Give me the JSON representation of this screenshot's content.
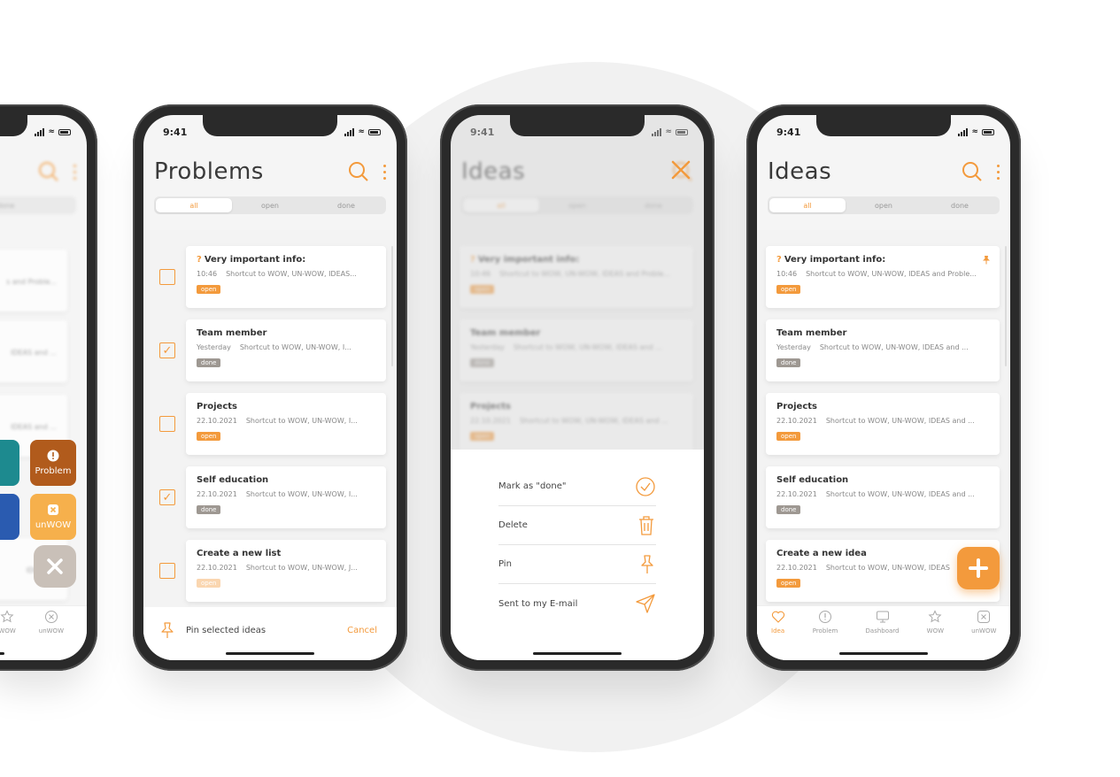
{
  "colors": {
    "accent": "#f39a3c",
    "done_tag": "#9e9892",
    "quick_problem": "#b15b1c",
    "quick_unwow": "#f6b04c",
    "quick_teal": "#1d8a8f",
    "quick_blue": "#2a5bb0"
  },
  "status": {
    "time": "9:41"
  },
  "phone1": {
    "filter_tab_done": "done",
    "snippets": [
      "s and Proble...",
      "IDEAS and ...",
      "IDEAS and ...",
      "IDEAS ..."
    ],
    "quick_actions": [
      {
        "label": "Problem",
        "icon": "exclamation-icon"
      },
      {
        "label": "unWOW",
        "icon": "close-box-icon"
      }
    ],
    "tabs": [
      "WOW",
      "unWOW"
    ]
  },
  "phone2": {
    "title": "Problems",
    "filter_tabs": [
      "all",
      "open",
      "done"
    ],
    "items": [
      {
        "prefix": "?",
        "title": "Very important info:",
        "time": "10:46",
        "text": "Shortcut to WOW, UN-WOW, IDEAS...",
        "tag": "open",
        "checked": false
      },
      {
        "prefix": "",
        "title": "Team member",
        "time": "Yesterday",
        "text": "Shortcut to WOW, UN-WOW, I...",
        "tag": "done",
        "checked": true
      },
      {
        "prefix": "",
        "title": "Projects",
        "time": "22.10.2021",
        "text": "Shortcut to WOW, UN-WOW, I...",
        "tag": "open",
        "checked": false
      },
      {
        "prefix": "",
        "title": "Self education",
        "time": "22.10.2021",
        "text": "Shortcut to WOW, UN-WOW, I...",
        "tag": "done",
        "checked": true
      },
      {
        "prefix": "",
        "title": "Create a new list",
        "time": "22.10.2021",
        "text": "Shortcut to WOW, UN-WOW, J...",
        "tag": "open",
        "checked": false
      }
    ],
    "bottom_left": "Pin selected ideas",
    "bottom_right": "Cancel"
  },
  "phone3": {
    "title": "Ideas",
    "filter_tabs": [
      "all",
      "open",
      "done"
    ],
    "items": [
      {
        "prefix": "?",
        "title": "Very important info:",
        "time": "10:46",
        "text": "Shortcut to WOW, UN-WOW, IDEAS and Proble...",
        "tag": "open"
      },
      {
        "prefix": "",
        "title": "Team member",
        "time": "Yesterday",
        "text": "Shortcut to WOW, UN-WOW, IDEAS and ...",
        "tag": "done"
      },
      {
        "prefix": "",
        "title": "Projects",
        "time": "22.10.2021",
        "text": "Shortcut to WOW, UN-WOW, IDEAS and ...",
        "tag": "open"
      }
    ],
    "sheet": [
      {
        "label": "Mark as \"done\"",
        "icon": "check-circle-icon"
      },
      {
        "label": "Delete",
        "icon": "trash-icon"
      },
      {
        "label": "Pin",
        "icon": "pin-icon"
      },
      {
        "label": "Sent to my E-mail",
        "icon": "send-icon"
      }
    ]
  },
  "phone4": {
    "title": "Ideas",
    "filter_tabs": [
      "all",
      "open",
      "done"
    ],
    "items": [
      {
        "prefix": "?",
        "title": "Very important info:",
        "time": "10:46",
        "text": "Shortcut to WOW, UN-WOW, IDEAS and Proble...",
        "tag": "open",
        "pinned": true
      },
      {
        "prefix": "",
        "title": "Team member",
        "time": "Yesterday",
        "text": "Shortcut to WOW, UN-WOW, IDEAS and ...",
        "tag": "done",
        "pinned": false
      },
      {
        "prefix": "",
        "title": "Projects",
        "time": "22.10.2021",
        "text": "Shortcut to WOW, UN-WOW, IDEAS and ...",
        "tag": "open",
        "pinned": false
      },
      {
        "prefix": "",
        "title": "Self education",
        "time": "22.10.2021",
        "text": "Shortcut to WOW, UN-WOW, IDEAS and ...",
        "tag": "done",
        "pinned": false
      },
      {
        "prefix": "",
        "title": "Create a new idea",
        "time": "22.10.2021",
        "text": "Shortcut to WOW, UN-WOW, IDEAS",
        "tag": "open",
        "pinned": false
      }
    ],
    "tabs": [
      {
        "label": "Idea",
        "icon": "heart-icon"
      },
      {
        "label": "Problem",
        "icon": "exclamation-circle-icon"
      },
      {
        "label": "Dashboard",
        "icon": "monitor-icon"
      },
      {
        "label": "WOW",
        "icon": "star-icon"
      },
      {
        "label": "unWOW",
        "icon": "close-box-icon"
      }
    ]
  }
}
